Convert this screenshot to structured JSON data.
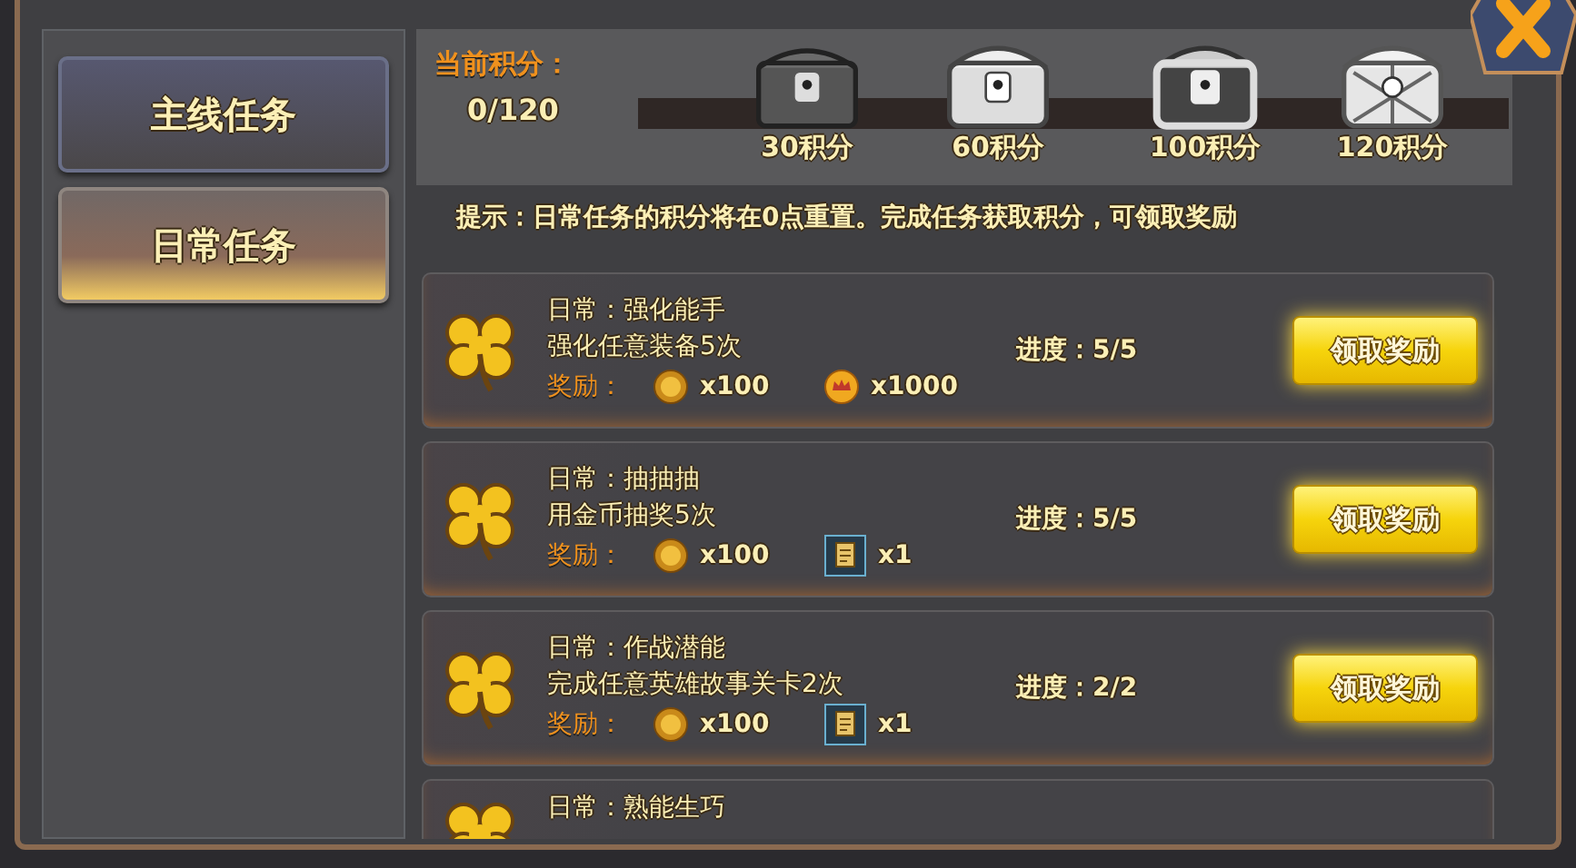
{
  "tabs": [
    {
      "label": "主线任务",
      "selected": false
    },
    {
      "label": "日常任务",
      "selected": true
    }
  ],
  "points": {
    "label": "当前积分：",
    "value": "0/120",
    "level": 0,
    "chests": [
      {
        "kind": "iron",
        "label": "30积分"
      },
      {
        "kind": "silver",
        "label": "60积分"
      },
      {
        "kind": "ornate",
        "label": "100积分"
      },
      {
        "kind": "lattice",
        "label": "120积分"
      }
    ]
  },
  "hint": "提示：日常任务的积分将在0点重置。完成任务获取积分，可领取奖励",
  "tasks": [
    {
      "title": "日常：强化能手",
      "desc": "强化任意装备5次",
      "progress_label": "进度：",
      "progress": "5/5",
      "reward_label": "奖励：",
      "rewards": [
        {
          "kind": "coin",
          "amount": "x100"
        },
        {
          "kind": "medal",
          "amount": "x1000"
        }
      ],
      "button": "领取奖励"
    },
    {
      "title": "日常：抽抽抽",
      "desc": "用金币抽奖5次",
      "progress_label": "进度：",
      "progress": "5/5",
      "reward_label": "奖励：",
      "rewards": [
        {
          "kind": "coin",
          "amount": "x100"
        },
        {
          "kind": "scroll",
          "amount": "x1"
        }
      ],
      "button": "领取奖励"
    },
    {
      "title": "日常：作战潜能",
      "desc": "完成任意英雄故事关卡2次",
      "progress_label": "进度：",
      "progress": "2/2",
      "reward_label": "奖励：",
      "rewards": [
        {
          "kind": "coin",
          "amount": "x100"
        },
        {
          "kind": "scroll",
          "amount": "x1"
        }
      ],
      "button": "领取奖励"
    },
    {
      "title": "日常：熟能生巧"
    }
  ]
}
